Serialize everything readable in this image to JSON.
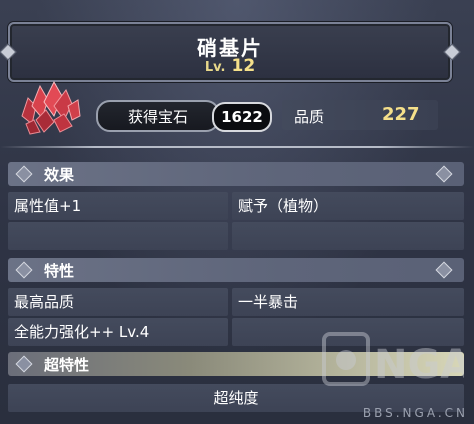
{
  "item": {
    "name": "硝基片",
    "level_prefix": "Lv.",
    "level": "12"
  },
  "stats": {
    "obtain_label": "获得宝石",
    "obtain_count": "1622",
    "quality_label": "品质",
    "quality_value": "227"
  },
  "sections": {
    "effects": {
      "title": "效果",
      "cells": [
        "属性值+1",
        "赋予（植物）",
        "",
        ""
      ]
    },
    "traits": {
      "title": "特性",
      "cells": [
        "最高品质",
        "一半暴击",
        "全能力强化++ Lv.4",
        ""
      ]
    },
    "super_traits": {
      "title": "超特性",
      "cells": [
        "超纯度"
      ]
    }
  },
  "watermark": {
    "text": "BBS.NGA.CN",
    "logo_text": "NGA"
  },
  "colors": {
    "gold": "#f5e08a",
    "section_bg": "#6b7286",
    "cell_bg": "#444b5d",
    "gem": "#d8424c"
  }
}
